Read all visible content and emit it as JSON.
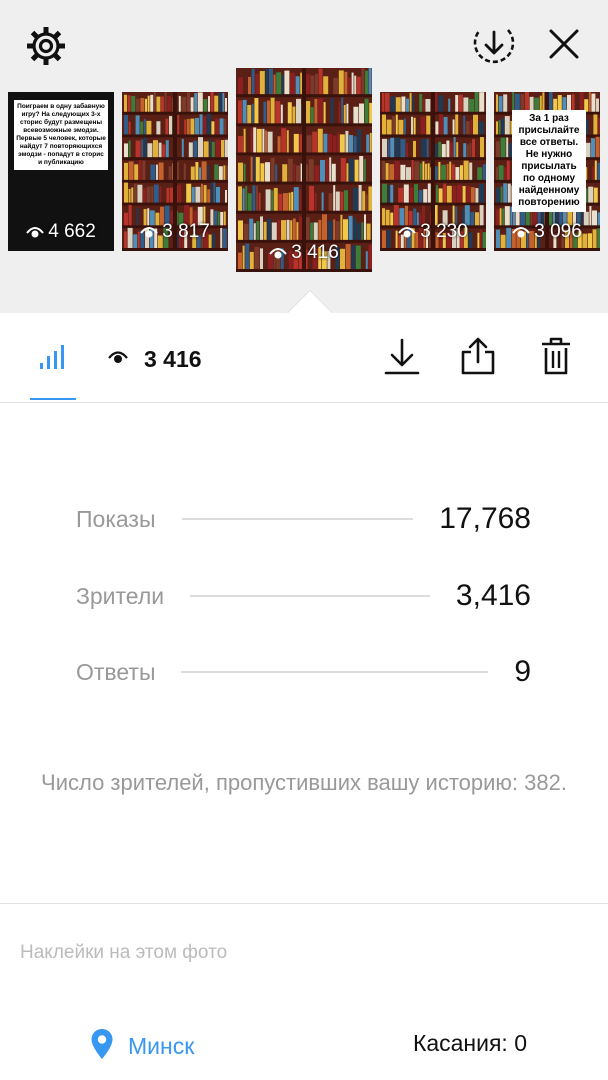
{
  "header": {
    "settings_icon": "gear-icon",
    "download_all_icon": "download-circle-icon",
    "close_icon": "close-icon"
  },
  "stories": [
    {
      "views": "4 662",
      "type": "text",
      "text": "Поиграем в одну забавную игру? На следующих 3-х сторис будут размещены всевозможные эмодзи. Первые 5 человек, которые найдут 7 повторяющихся эмодзи - попадут в сторис и публикацию"
    },
    {
      "views": "3 817",
      "type": "bookshelf"
    },
    {
      "views": "3 416",
      "type": "bookshelf",
      "selected": true
    },
    {
      "views": "3 230",
      "type": "bookshelf"
    },
    {
      "views": "3 096",
      "type": "bookshelf-text",
      "text": "За 1 раз присылайте все ответы. Не нужно присылать по одному найденному повторению"
    }
  ],
  "toolbar": {
    "views": "3 416",
    "insights_icon": "bar-chart-icon",
    "eye_icon": "eye-icon",
    "download_icon": "download-icon",
    "share_icon": "share-icon",
    "delete_icon": "trash-icon",
    "accent": "#3897f0"
  },
  "stats": [
    {
      "label": "Показы",
      "value": "17,768"
    },
    {
      "label": "Зрители",
      "value": "3,416"
    },
    {
      "label": "Ответы",
      "value": "9"
    }
  ],
  "skipped_note": "Число зрителей, пропустивших вашу историю: 382.",
  "stickers": {
    "heading": "Наклейки на этом фото",
    "location_name": "Минск",
    "taps": "Касания: 0",
    "pin_icon": "location-pin-icon"
  }
}
